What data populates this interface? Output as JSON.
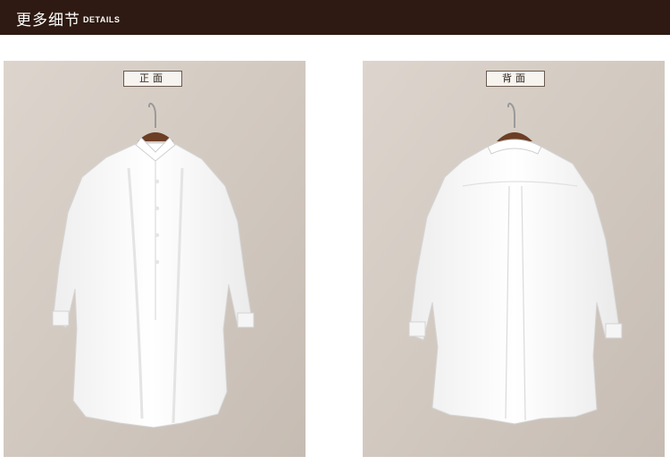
{
  "header": {
    "title_cn": "更多细节",
    "title_en": "DETAILS"
  },
  "panels": [
    {
      "label": "正面"
    },
    {
      "label": "背面"
    }
  ],
  "colors": {
    "header_bg": "#2e1a12",
    "panel_bg": "#cfc6be",
    "shirt": "#fafafa"
  }
}
